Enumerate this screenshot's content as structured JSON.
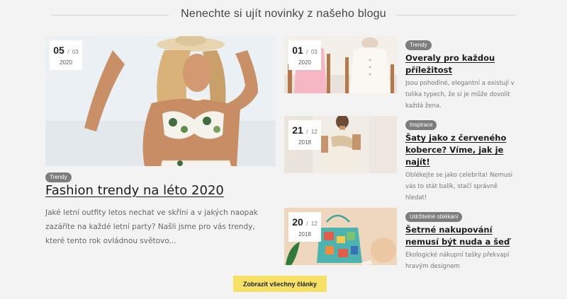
{
  "section": {
    "title": "Nenechte si ujít novinky z našeho blogu"
  },
  "featured": {
    "date": {
      "day": "05",
      "month": "03",
      "year": "2020"
    },
    "tag": "Trendy",
    "title": "Fashion trendy na léto 2020",
    "excerpt": "Jaké letní outfity letos nechat ve skříni a v jakých naopak zazáříte na každé letní party? Našli jsme pro vás trendy, které tento rok ovládnou světovo..."
  },
  "posts": [
    {
      "date": {
        "day": "01",
        "month": "03",
        "year": "2020"
      },
      "tag": "Trendy",
      "title": "Overaly pro každou příležitost",
      "excerpt": "Jsou pohodlné, elegantní a existují v tolika typech, že si je může dovolit každá žena."
    },
    {
      "date": {
        "day": "21",
        "month": "12",
        "year": "2018"
      },
      "tag": "Inspirace",
      "title": "Šaty jako z červeného koberce? Víme, jak je najít!",
      "excerpt": "Oblékejte se jako celebrita! Nemusí vás to stát balík, stačí správně hledat!"
    },
    {
      "date": {
        "day": "20",
        "month": "12",
        "year": "2018"
      },
      "tag": "Udržitelné oblékání",
      "title": "Šetrné nakupování nemusí být nuda a šeď",
      "excerpt": "Ekologické nákupní tašky překvapí hravým designem"
    }
  ],
  "button": {
    "label": "Zobrazit všechny články"
  },
  "colors": {
    "tag": "#7d7d7d",
    "button": "#f6e066",
    "background": "#f3f3f3"
  }
}
